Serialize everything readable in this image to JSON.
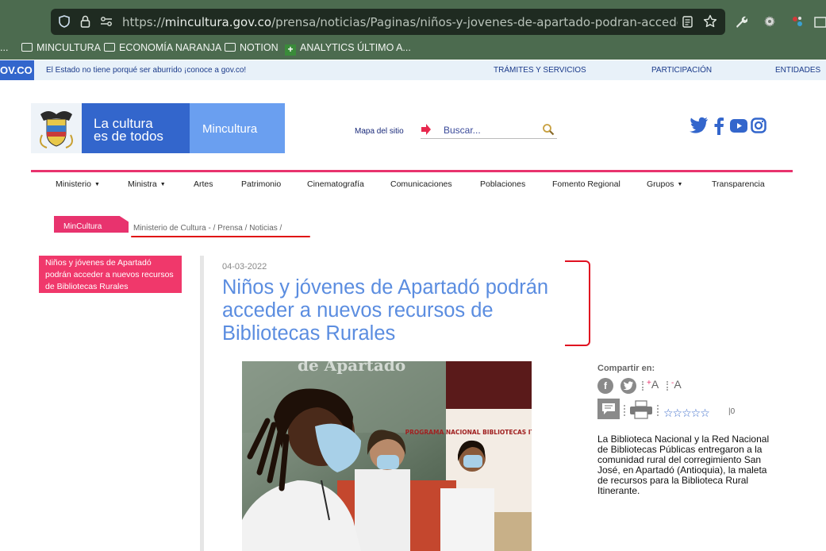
{
  "browser": {
    "url_prefix": "https://",
    "url_host": "mincultura.gov.co",
    "url_path": "/prensa/noticias/Paginas/niños-y-jovenes-de-apartado-podran-acceder-a-nuevos-recurso",
    "bookmarks": [
      {
        "label": "...",
        "icon": "folder-icon"
      },
      {
        "label": "MINCULTURA",
        "icon": "folder-icon"
      },
      {
        "label": "ECONOMÍA NARANJA",
        "icon": "folder-icon"
      },
      {
        "label": "NOTION",
        "icon": "folder-icon"
      },
      {
        "label": "ANALYTICS ÚLTIMO A...",
        "icon": "plus-icon"
      }
    ]
  },
  "govbar": {
    "logo": "OV.CO",
    "tagline": "El Estado no tiene porqué ser aburrido ¡conoce a gov.co!",
    "links": [
      "TRÁMITES Y SERVICIOS",
      "PARTICIPACIÓN",
      "ENTIDADES"
    ]
  },
  "header": {
    "slogan_line1": "La cultura",
    "slogan_line2": "es de todos",
    "brand": "Mincultura",
    "sitemap": "Mapa del sitio",
    "search_placeholder": "Buscar..."
  },
  "nav": {
    "items": [
      "Ministerio",
      "Ministra",
      "Artes",
      "Patrimonio",
      "Cinematografía",
      "Comunicaciones",
      "Poblaciones",
      "Fomento Regional",
      "Grupos",
      "Transparencia"
    ]
  },
  "breadcrumb": {
    "tag": "MinCultura",
    "trail": [
      "Ministerio de Cultura -",
      "/",
      "Prensa",
      "/",
      "Noticias",
      "/"
    ]
  },
  "sidebar": {
    "active_item": "Niños y jóvenes de Apartadó podrán acceder a nuevos recursos de Bibliotecas Rurales"
  },
  "article": {
    "date": "04-03-2022",
    "title": "Niños y jóvenes de Apartadó podrán acceder a nuevos recursos de Bibliotecas Rurales",
    "photo_banner_text": "PROGRAMA NACIONAL BIBLIOTECAS ITINERANTES",
    "photo_backdrop_text": "de Apartado"
  },
  "aside": {
    "share_label": "Compartir en:",
    "font_increase": "A",
    "font_decrease": "A",
    "rating_count": "0",
    "summary": "La Biblioteca Nacional y la Red Nacional de Bibliotecas Públicas entregaron a la comunidad rural del corregimiento San José, en Apartadó (Antioquia), la maleta de recursos para la Biblioteca Rural Itinerante."
  },
  "colors": {
    "brand_blue": "#3366cc",
    "accent_pink": "#e8336e",
    "title_blue": "#5b8de0",
    "chrome_green": "#4c6b4f"
  }
}
